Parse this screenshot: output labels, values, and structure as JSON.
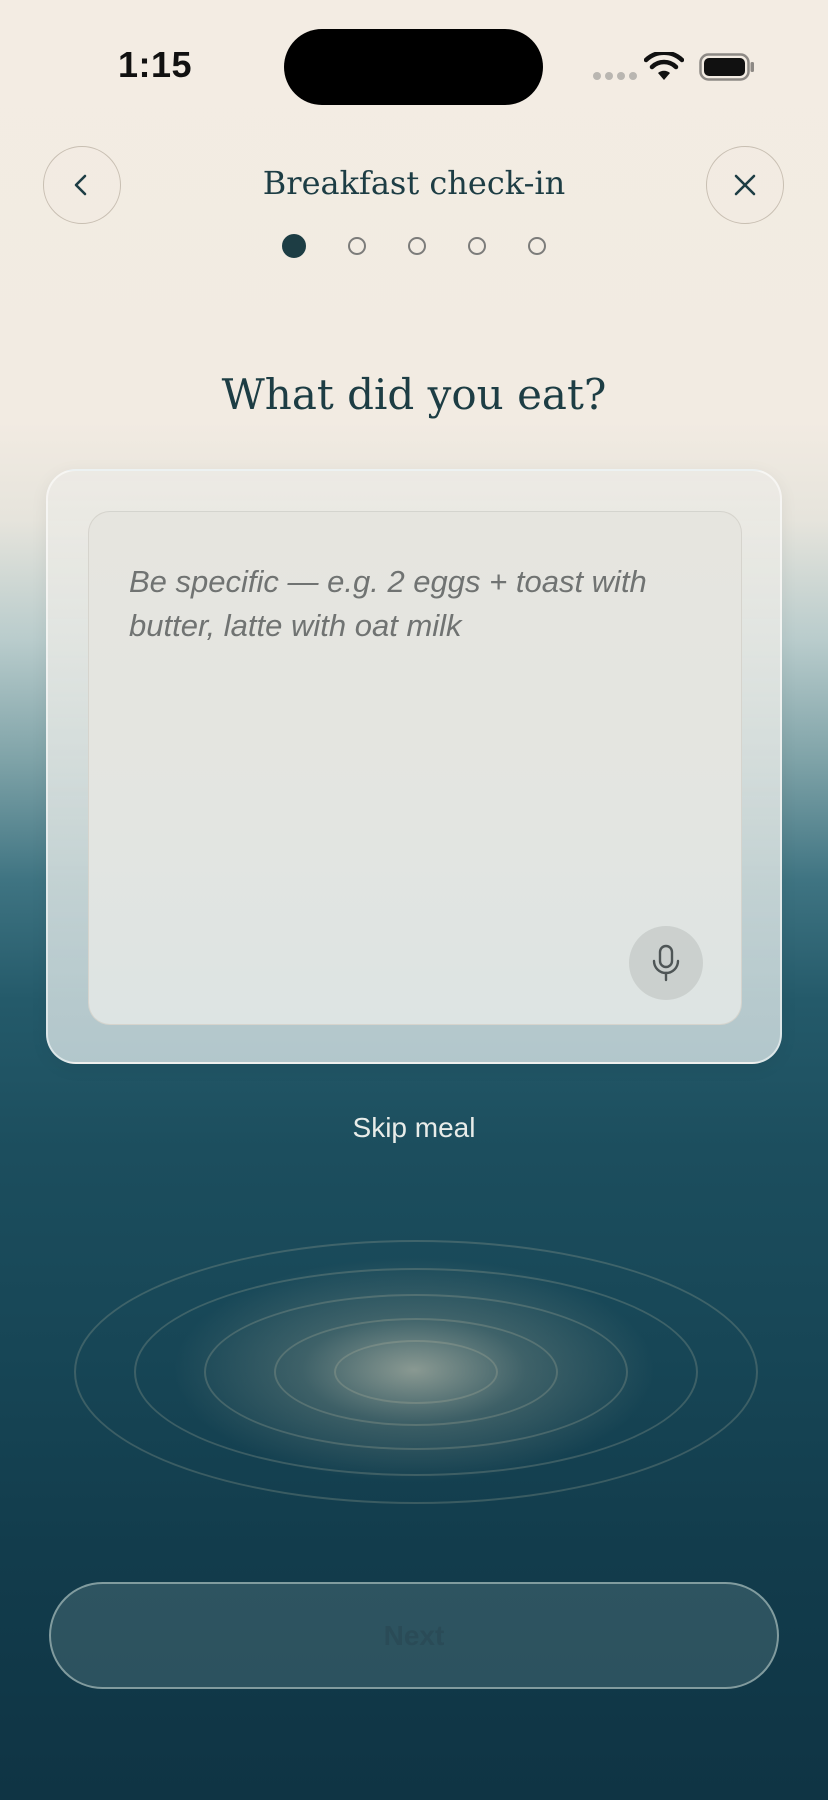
{
  "status_bar": {
    "time": "1:15"
  },
  "header": {
    "title": "Breakfast check-in",
    "back_icon": "chevron-left-icon",
    "close_icon": "close-icon",
    "steps_total": 5,
    "current_step": 1
  },
  "main": {
    "question": "What did you eat?",
    "input": {
      "placeholder": "Be specific — e.g. 2 eggs + toast with butter, latte with oat milk",
      "value": ""
    },
    "mic_icon": "microphone-icon",
    "skip_label": "Skip meal"
  },
  "footer": {
    "next_label": "Next",
    "next_enabled": false
  },
  "colors": {
    "accent": "#1d3d44",
    "background_top": "#f3ece3",
    "background_bottom": "#0f3444"
  }
}
